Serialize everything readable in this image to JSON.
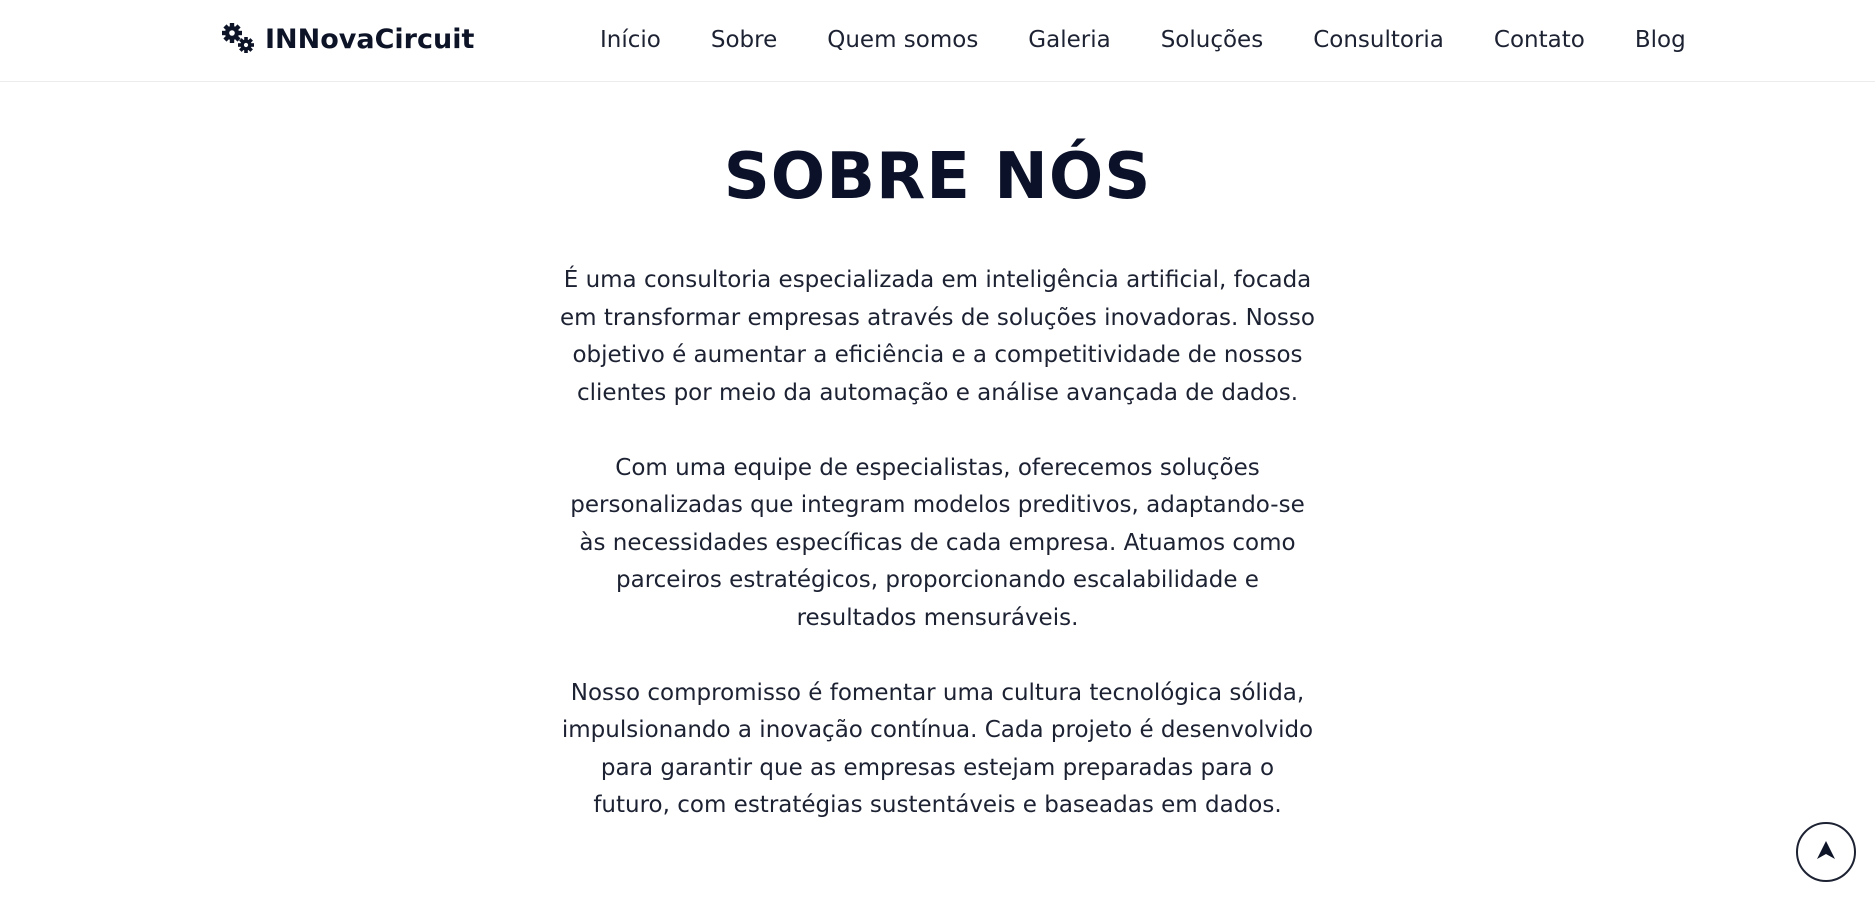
{
  "brand": {
    "name": "INNovaCircuit",
    "icon": "gears-icon"
  },
  "nav": {
    "items": [
      "Início",
      "Sobre",
      "Quem somos",
      "Galeria",
      "Soluções",
      "Consultoria",
      "Contato",
      "Blog"
    ]
  },
  "about": {
    "title": "SOBRE NÓS",
    "paragraphs": [
      "É uma consultoria especializada em inteligência artificial, focada em transformar empresas através de soluções inovadoras. Nosso objetivo é aumentar a eficiência e a competitividade de nossos clientes por meio da automação e análise avançada de dados.",
      "Com uma equipe de especialistas, oferecemos soluções personalizadas que integram modelos preditivos, adaptando-se às necessidades específicas de cada empresa. Atuamos como parceiros estratégicos, proporcionando escalabilidade e resultados mensuráveis.",
      "Nosso compromisso é fomentar uma cultura tecnológica sólida, impulsionando a inovação contínua. Cada projeto é desenvolvido para garantir que as empresas estejam preparadas para o futuro, com estratégias sustentáveis e baseadas em dados."
    ]
  },
  "scroll_top": {
    "icon": "arrow-up-icon"
  },
  "colors": {
    "text": "#1d2233",
    "heading": "#0b1128",
    "background": "#ffffff"
  }
}
